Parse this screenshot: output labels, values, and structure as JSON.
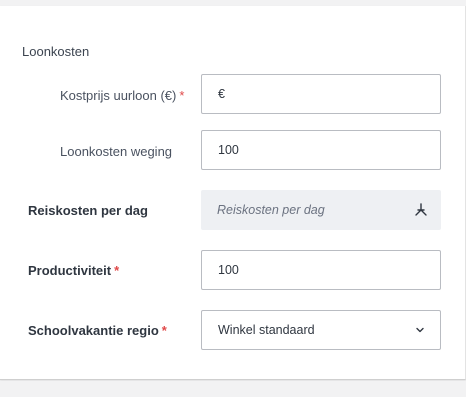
{
  "section": {
    "title": "Loonkosten"
  },
  "fields": {
    "kostprijs": {
      "label": "Kostprijs uurloon (€)",
      "required_mark": "*",
      "value": "€"
    },
    "weging": {
      "label": "Loonkosten weging",
      "value": "100"
    },
    "reiskosten": {
      "label": "Reiskosten per dag",
      "placeholder": "Reiskosten per dag",
      "icon": "fork-icon"
    },
    "productiviteit": {
      "label": "Productiviteit",
      "required_mark": "*",
      "value": "100"
    },
    "schoolvakantie": {
      "label": "Schoolvakantie regio",
      "required_mark": "*",
      "selected": "Winkel standaard",
      "icon": "chevron-down-icon"
    }
  }
}
